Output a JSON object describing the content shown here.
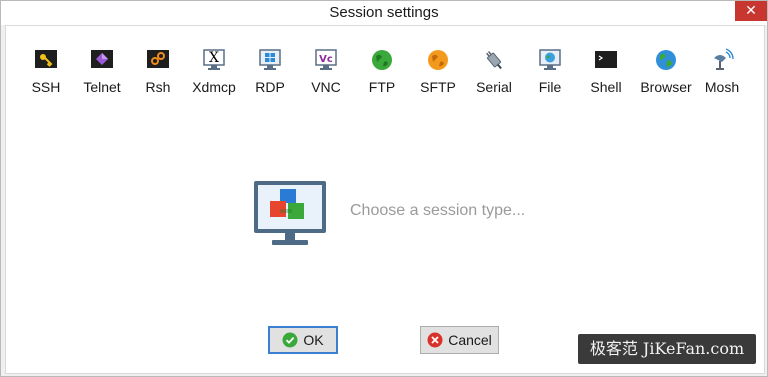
{
  "window": {
    "title": "Session settings",
    "close_glyph": "✕"
  },
  "session_types": [
    {
      "label": "SSH",
      "icon": "key-icon"
    },
    {
      "label": "Telnet",
      "icon": "telnet-icon"
    },
    {
      "label": "Rsh",
      "icon": "rsh-icon"
    },
    {
      "label": "Xdmcp",
      "icon": "xdmcp-icon"
    },
    {
      "label": "RDP",
      "icon": "rdp-icon"
    },
    {
      "label": "VNC",
      "icon": "vnc-icon"
    },
    {
      "label": "FTP",
      "icon": "ftp-globe-icon"
    },
    {
      "label": "SFTP",
      "icon": "sftp-globe-icon"
    },
    {
      "label": "Serial",
      "icon": "serial-plug-icon"
    },
    {
      "label": "File",
      "icon": "file-monitor-icon"
    },
    {
      "label": "Shell",
      "icon": "terminal-icon"
    },
    {
      "label": "Browser",
      "icon": "browser-globe-icon"
    },
    {
      "label": "Mosh",
      "icon": "mosh-antenna-icon"
    }
  ],
  "prompt": "Choose a session type...",
  "buttons": {
    "ok": "OK",
    "cancel": "Cancel"
  },
  "watermark": "极客范 JiKeFan.com"
}
